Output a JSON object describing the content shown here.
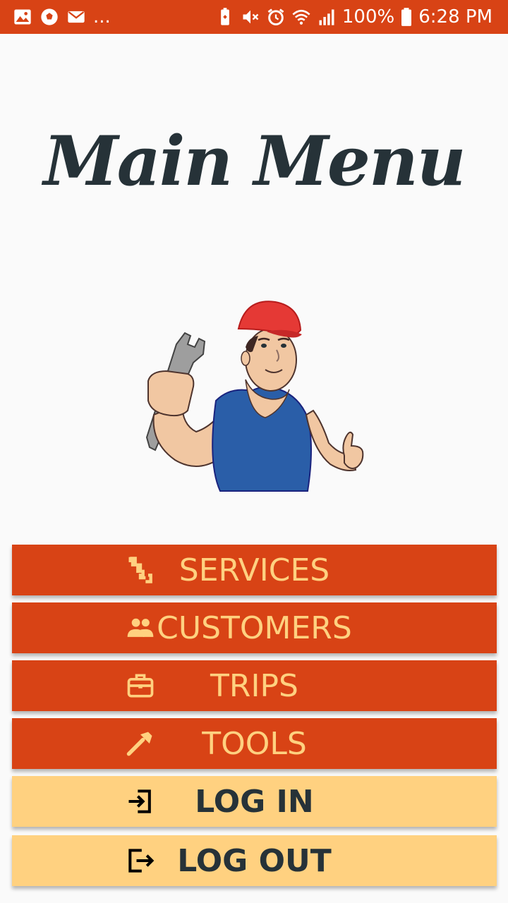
{
  "status_bar": {
    "notification_overflow": "...",
    "battery_percent": "100%",
    "time": "6:28 PM",
    "left_icons": [
      "gallery-icon",
      "soccer-ball-icon",
      "mail-icon"
    ],
    "right_icons": [
      "battery-saver-icon",
      "mute-icon",
      "alarm-icon",
      "wifi-icon",
      "signal-icon",
      "battery-icon"
    ]
  },
  "page": {
    "title": "Main Menu"
  },
  "menu": {
    "items": [
      {
        "label": "SERVICES",
        "icon": "services-icon"
      },
      {
        "label": "CUSTOMERS",
        "icon": "people-icon"
      },
      {
        "label": "TRIPS",
        "icon": "briefcase-icon"
      },
      {
        "label": "TOOLS",
        "icon": "hammer-icon"
      },
      {
        "label": "LOG IN",
        "icon": "login-icon"
      },
      {
        "label": "LOG OUT",
        "icon": "logout-icon"
      }
    ]
  },
  "colors": {
    "accent": "#d84315",
    "button_text_orange": "#ffd180",
    "button_bg_yellow": "#ffd180",
    "dark_text": "#263238",
    "background": "#fafafa"
  }
}
